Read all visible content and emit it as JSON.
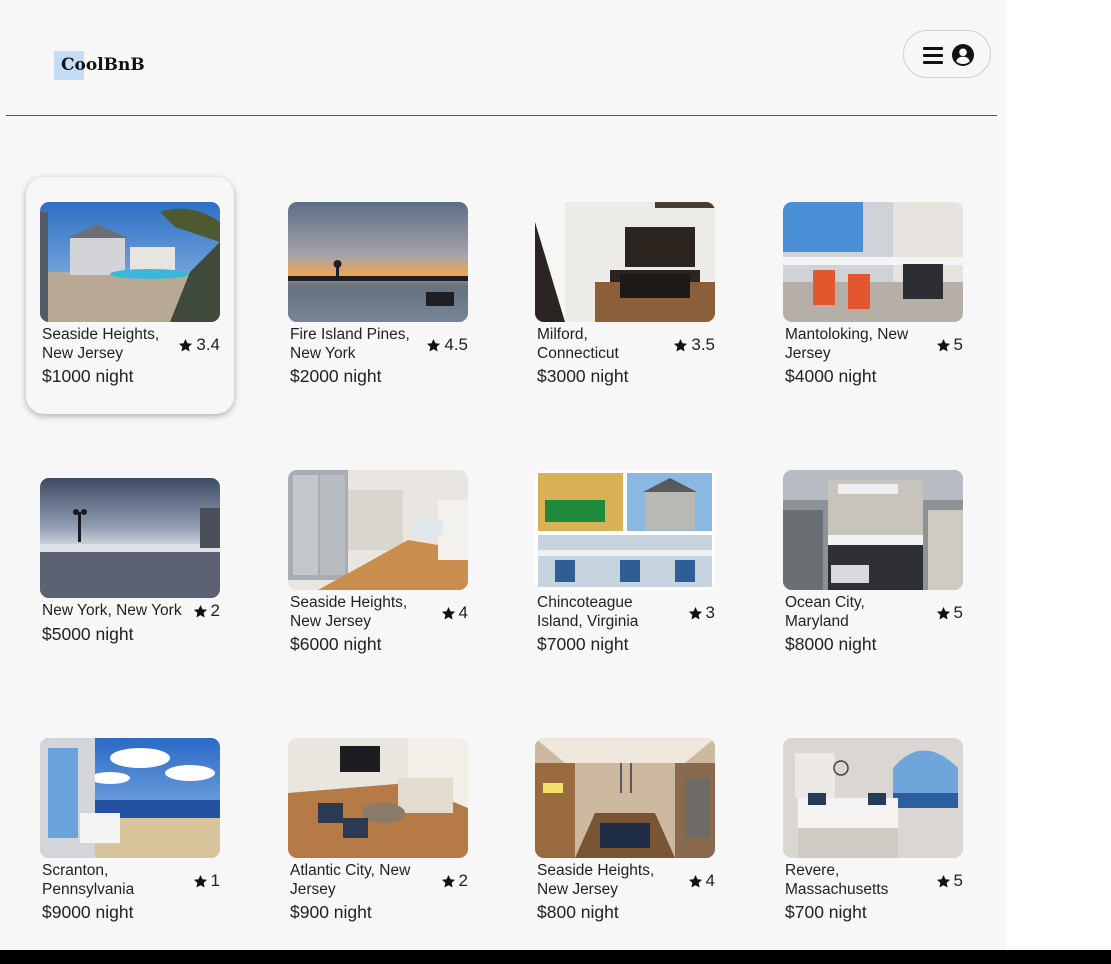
{
  "app": {
    "logo": "CoolBnB",
    "menu_icon": "hamburger-icon",
    "user_icon": "user-circle-icon"
  },
  "colors": {
    "page_background": "#f7f7f7",
    "text": "#222222",
    "logo_highlight": "#c5dcf5",
    "divider": "#555555"
  },
  "listings": [
    {
      "location": "Seaside Heights, New Jersey",
      "rating": "3.4",
      "price": "$1000 night",
      "photo": "house-with-pool-photo"
    },
    {
      "location": "Fire Island Pines, New York",
      "rating": "4.5",
      "price": "$2000 night",
      "photo": "sunset-over-bay-photo"
    },
    {
      "location": "Milford, Connecticut",
      "rating": "3.5",
      "price": "$3000 night",
      "photo": "kitchen-interior-photo"
    },
    {
      "location": "Mantoloking, New Jersey",
      "rating": "5",
      "price": "$4000 night",
      "photo": "deck-with-chairs-photo"
    },
    {
      "location": "New York, New York",
      "rating": "2",
      "price": "$5000 night",
      "photo": "ocean-view-rooftop-photo"
    },
    {
      "location": "Seaside Heights, New Jersey",
      "rating": "4",
      "price": "$6000 night",
      "photo": "steel-kitchen-photo"
    },
    {
      "location": "Chincoteague Island, Virginia",
      "rating": "3",
      "price": "$7000 night",
      "photo": "photo-collage"
    },
    {
      "location": "Ocean City, Maryland",
      "rating": "5",
      "price": "$8000 night",
      "photo": "tall-beach-house-photo"
    },
    {
      "location": "Scranton, Pennsylvania",
      "rating": "1",
      "price": "$9000 night",
      "photo": "beach-from-porch-photo"
    },
    {
      "location": "Atlantic City, New Jersey",
      "rating": "2",
      "price": "$900 night",
      "photo": "living-room-photo"
    },
    {
      "location": "Seaside Heights, New Jersey",
      "rating": "4",
      "price": "$800 night",
      "photo": "dining-kitchen-photo"
    },
    {
      "location": "Revere, Massachusetts",
      "rating": "5",
      "price": "$700 night",
      "photo": "bedroom-ocean-view-photo"
    }
  ]
}
